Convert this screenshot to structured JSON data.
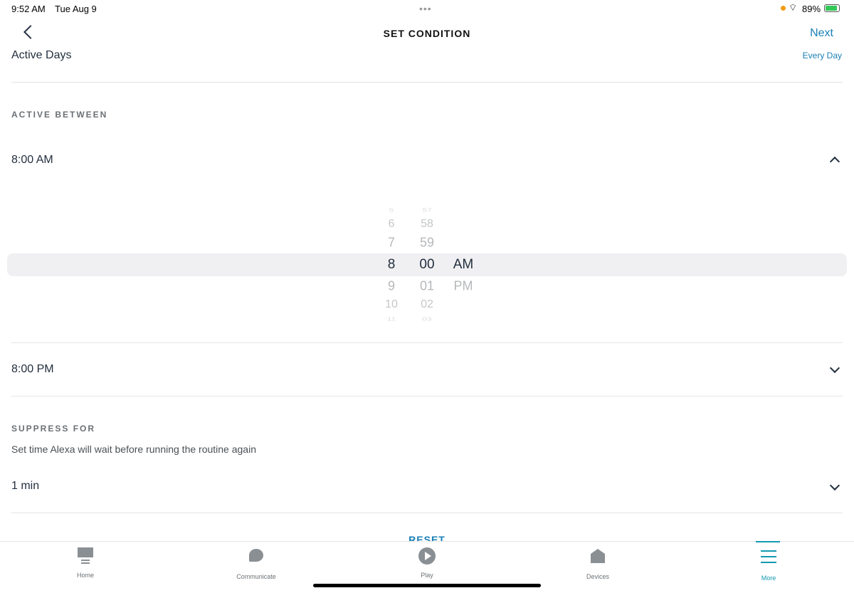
{
  "status_bar": {
    "time": "9:52 AM",
    "date": "Tue Aug 9",
    "battery": "89%"
  },
  "header": {
    "title": "SET CONDITION",
    "next_label": "Next"
  },
  "active_days": {
    "label": "Active Days",
    "value": "Every Day"
  },
  "active_between": {
    "heading": "ACTIVE BETWEEN",
    "start": "8:00 AM",
    "end": "8:00 PM"
  },
  "picker": {
    "hours": [
      "5",
      "6",
      "7",
      "8",
      "9",
      "10",
      "11"
    ],
    "minutes": [
      "57",
      "58",
      "59",
      "00",
      "01",
      "02",
      "03"
    ],
    "periods": [
      "AM",
      "PM"
    ],
    "selected": {
      "hour": "8",
      "minute": "00",
      "period": "AM"
    }
  },
  "suppress": {
    "heading": "SUPPRESS FOR",
    "description": "Set time Alexa will wait before running the routine again",
    "value": "1 min"
  },
  "reset_label": "RESET",
  "tabs": [
    {
      "label": "Home",
      "icon": "home-icon"
    },
    {
      "label": "Communicate",
      "icon": "communicate-icon"
    },
    {
      "label": "Play",
      "icon": "play-icon"
    },
    {
      "label": "Devices",
      "icon": "devices-icon"
    },
    {
      "label": "More",
      "icon": "more-icon",
      "active": true
    }
  ],
  "colors": {
    "accent": "#1a7fb5",
    "active_tab": "#1399b1",
    "text": "#232f3e"
  }
}
